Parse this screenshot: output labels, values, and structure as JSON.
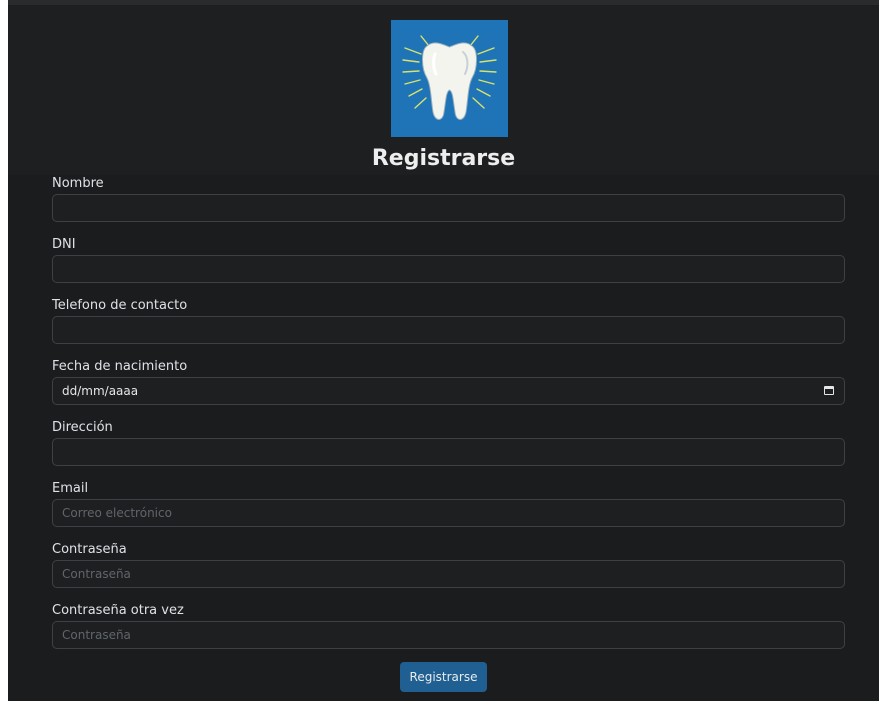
{
  "app": {
    "title": "Registrarse"
  },
  "logo": {
    "icon": "tooth-icon",
    "background": "#1f73b7"
  },
  "form": {
    "fields": [
      {
        "label": "Nombre",
        "value": "",
        "placeholder": ""
      },
      {
        "label": "DNI",
        "value": "",
        "placeholder": ""
      },
      {
        "label": "Telefono de contacto",
        "value": "",
        "placeholder": ""
      },
      {
        "label": "Fecha de nacimiento",
        "value": "dd/mm/aaaa",
        "placeholder": ""
      },
      {
        "label": "Dirección",
        "value": "",
        "placeholder": ""
      },
      {
        "label": "Email",
        "value": "",
        "placeholder": "Correo electrónico"
      },
      {
        "label": "Contraseña",
        "value": "",
        "placeholder": "Contraseña"
      },
      {
        "label": "Contraseña otra vez",
        "value": "",
        "placeholder": "Contraseña"
      }
    ],
    "submit_label": "Registrarse"
  },
  "colors": {
    "background": "#1b1c1e",
    "accent": "#1f5f91"
  }
}
